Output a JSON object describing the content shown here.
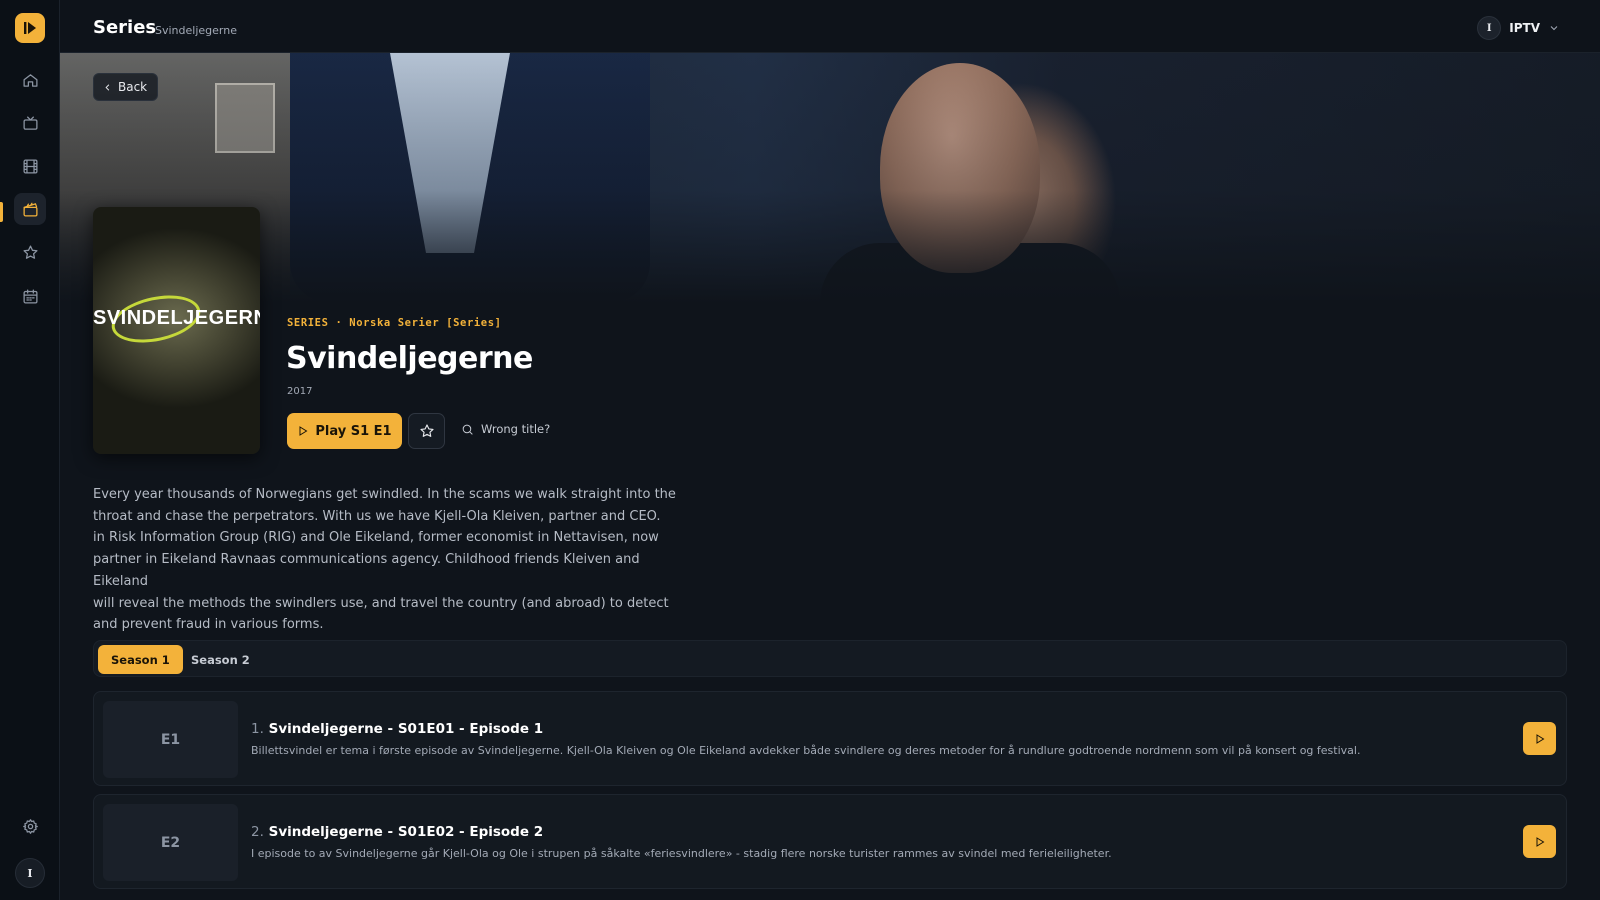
{
  "app": {
    "accent_color": "#f3b23a",
    "logo_icon": "play-logo-icon"
  },
  "header": {
    "title": "Series",
    "subtitle": "Svindeljegerne",
    "profile": {
      "initial": "I",
      "name": "IPTV"
    }
  },
  "sidebar": {
    "items": [
      {
        "name": "home",
        "icon": "home-icon"
      },
      {
        "name": "live-tv",
        "icon": "tv-icon"
      },
      {
        "name": "movies",
        "icon": "film-icon"
      },
      {
        "name": "series",
        "icon": "clapperboard-icon",
        "active": true
      },
      {
        "name": "favorites",
        "icon": "star-icon"
      },
      {
        "name": "guide",
        "icon": "calendar-icon"
      }
    ],
    "settings_icon": "gear-icon",
    "avatar_initial": "I"
  },
  "hero": {
    "back_label": "Back"
  },
  "poster": {
    "logo_text": "SVINDELJEGERNE"
  },
  "show": {
    "category": "SERIES · Norska Serier [Series]",
    "title": "Svindeljegerne",
    "year": "2017",
    "play_label": "Play S1 E1",
    "wrong_title_label": "Wrong title?",
    "description": "Every year thousands of Norwegians get swindled. In the scams we walk straight into the\nthroat and chase the perpetrators. With us we have Kjell-Ola Kleiven, partner and CEO.\nin Risk Information Group (RIG) and Ole Eikeland, former economist in Nettavisen, now\npartner in Eikeland Ravnaas communications agency. Childhood friends Kleiven and Eikeland\nwill reveal the methods the swindlers use, and travel the country (and abroad) to detect\nand prevent fraud in various forms."
  },
  "seasons": {
    "tabs": [
      {
        "label": "Season 1",
        "active": true
      },
      {
        "label": "Season 2",
        "active": false
      }
    ]
  },
  "episodes": [
    {
      "thumb": "E1",
      "number": "1.",
      "title": "Svindeljegerne - S01E01 - Episode 1",
      "description": "Billettsvindel er tema i første episode av Svindeljegerne. Kjell-Ola Kleiven og Ole Eikeland avdekker både svindlere og deres metoder for å rundlure godtroende nordmenn som vil på konsert og festival."
    },
    {
      "thumb": "E2",
      "number": "2.",
      "title": "Svindeljegerne - S01E02 - Episode 2",
      "description": "I episode to av Svindeljegerne går Kjell-Ola og Ole i strupen på såkalte «feriesvindlere» - stadig flere norske turister rammes av svindel med ferieleiligheter."
    }
  ]
}
